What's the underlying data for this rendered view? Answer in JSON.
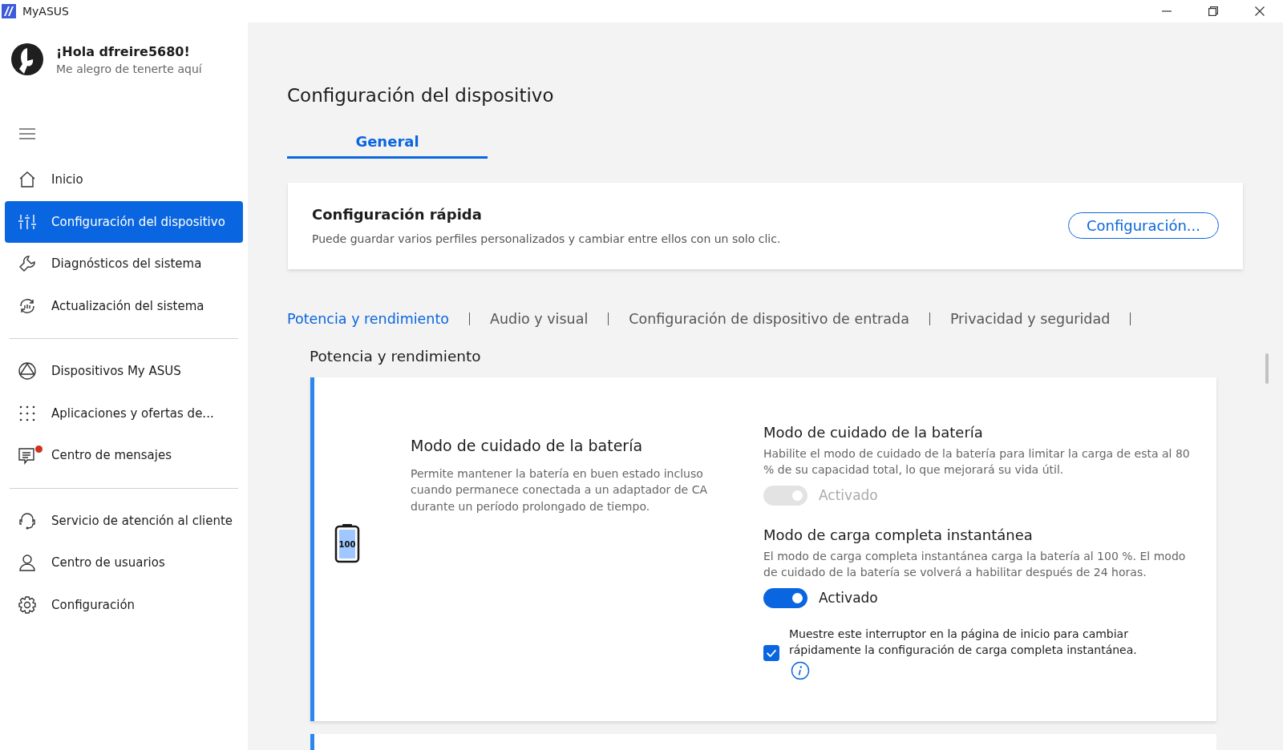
{
  "window": {
    "title": "MyASUS"
  },
  "user": {
    "greeting": "¡Hola dfreire5680!",
    "subtitle": "Me alegro de tenerte aquí"
  },
  "sidebar": {
    "groups": [
      [
        {
          "label": "Inicio",
          "kind": "home",
          "selected": false,
          "badge": false
        },
        {
          "label": "Configuración del dispositivo",
          "kind": "sliders",
          "selected": true,
          "badge": false
        },
        {
          "label": "Diagnósticos del sistema",
          "kind": "wrench",
          "selected": false,
          "badge": false
        },
        {
          "label": "Actualización del sistema",
          "kind": "update",
          "selected": false,
          "badge": false
        }
      ],
      [
        {
          "label": "Dispositivos My ASUS",
          "kind": "devices",
          "selected": false,
          "badge": false
        },
        {
          "label": "Aplicaciones y ofertas de...",
          "kind": "grid",
          "selected": false,
          "badge": false
        },
        {
          "label": "Centro de mensajes",
          "kind": "message",
          "selected": false,
          "badge": true
        }
      ],
      [
        {
          "label": "Servicio de atención al cliente",
          "kind": "headset",
          "selected": false,
          "badge": false
        },
        {
          "label": "Centro de usuarios",
          "kind": "user",
          "selected": false,
          "badge": false
        },
        {
          "label": "Configuración",
          "kind": "gear",
          "selected": false,
          "badge": false
        }
      ]
    ]
  },
  "page": {
    "title": "Configuración del dispositivo",
    "tabs": [
      {
        "label": "General",
        "selected": true
      }
    ],
    "quick_settings": {
      "title": "Configuración rápida",
      "description": "Puede guardar varios perfiles personalizados y cambiar entre ellos con un solo clic.",
      "button": "Configuración..."
    },
    "section_tabs": [
      {
        "label": "Potencia y rendimiento",
        "selected": true
      },
      {
        "label": "Audio y visual",
        "selected": false
      },
      {
        "label": "Configuración de dispositivo de entrada",
        "selected": false
      },
      {
        "label": "Privacidad y seguridad",
        "selected": false
      }
    ],
    "section_title": "Potencia y rendimiento",
    "feature": {
      "title": "Modo de cuidado de la batería",
      "description": "Permite mantener la batería en buen estado incluso cuando permanece conectada a un adaptador de CA durante un período prolongado de tiempo.",
      "battery_label": "100",
      "settings": [
        {
          "kind": "toggle",
          "title": "Modo de cuidado de la batería",
          "description": "Habilite el modo de cuidado de la batería para limitar la carga de esta al 80 % de su capacidad total, lo que mejorará su vida útil.",
          "on": true,
          "disabled": true,
          "toggle_label": "Activado"
        },
        {
          "kind": "toggle",
          "title": "Modo de carga completa instantánea",
          "description": "El modo de carga completa instantánea carga la batería al 100 %. El modo de cuidado de la batería se volverá a habilitar después de 24 horas.",
          "on": true,
          "disabled": false,
          "toggle_label": "Activado"
        },
        {
          "kind": "checkbox",
          "label": "Muestre este interruptor en la página de inicio para cambiar rápidamente la configuración de carga completa instantánea.",
          "checked": true
        }
      ]
    }
  }
}
